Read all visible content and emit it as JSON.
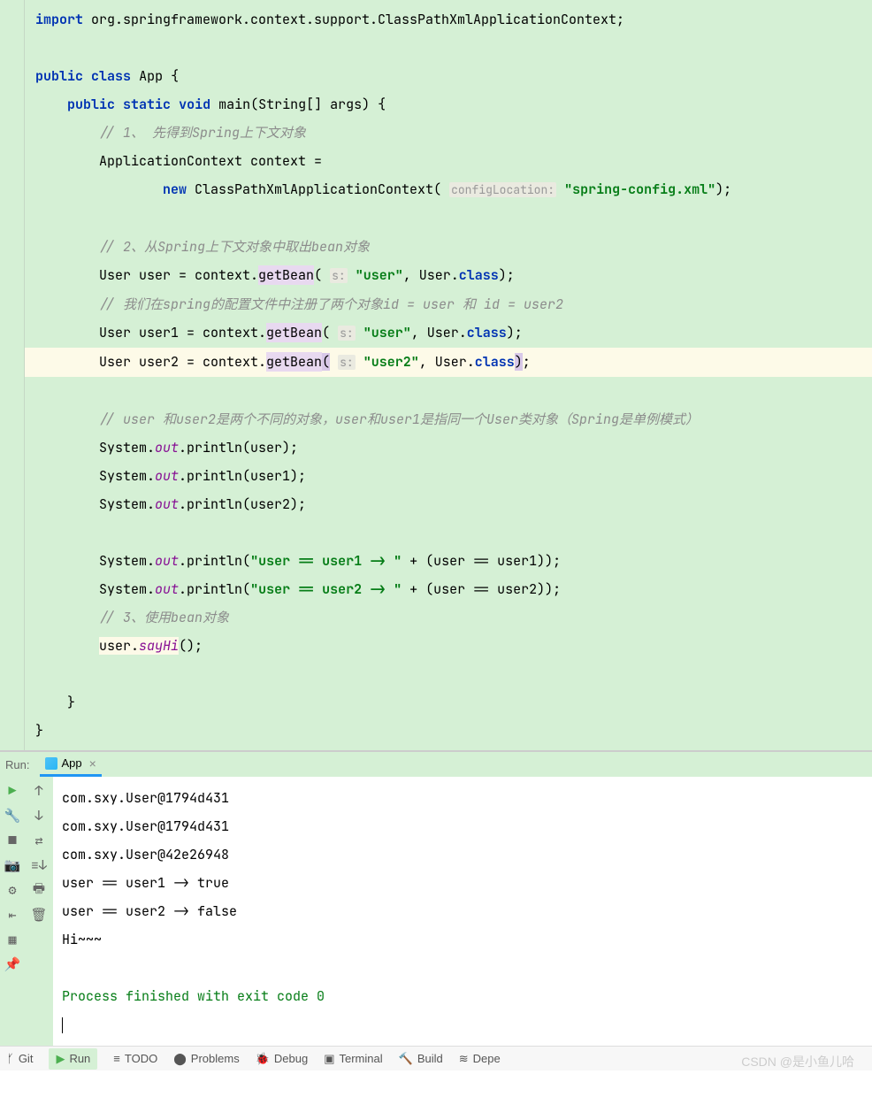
{
  "code": {
    "import": "import",
    "import_pkg": "org.springframework.context.support.ClassPathXmlApplicationContext;",
    "public": "public",
    "class": "class",
    "App": "App {",
    "static": "static",
    "void": "void",
    "main": "main(String[] args) {",
    "new": "new",
    "c1": "// 1、 先得到Spring上下文对象",
    "l1": "ApplicationContext context =",
    "l2a": "ClassPathXmlApplicationContext(",
    "hint_config": "configLocation:",
    "str_config": "\"spring-config.xml\"",
    "l2b": ");",
    "c2": "// 2、从Spring上下文对象中取出bean对象",
    "hint_s": "s:",
    "l3a": "User user = context.",
    "getBean": "getBean",
    "l3b": "(",
    "str_user": "\"user\"",
    "l3c": ", User.",
    "class_kw": "class",
    "l3d": ");",
    "c3": "// 我们在spring的配置文件中注册了两个对象id = user 和 id = user2",
    "l4a": "User user1 = context.",
    "l5a": "User user2 = context.",
    "str_user2": "\"user2\"",
    "c4": "// user 和user2是两个不同的对象，user和user1是指同一个User类对象（Spring是单例模式）",
    "sys": "System.",
    "out": "out",
    "pr1": ".println(user);",
    "pr2": ".println(user1);",
    "pr3": ".println(user2);",
    "str_cmp1": "\"user == user1 -> \"",
    "cmp1b": " + (user == user1));",
    "str_cmp2": "\"user == user2 -> \"",
    "cmp2b": " + (user == user2));",
    "pr_open": ".println(",
    "c5": "// 3、使用bean对象",
    "sayHi_a": "user.",
    "sayHi": "sayHi",
    "sayHi_b": "();",
    "rbrace": "}"
  },
  "run": {
    "label": "Run:",
    "tab": "App",
    "out1": "com.sxy.User@1794d431",
    "out2": "com.sxy.User@1794d431",
    "out3": "com.sxy.User@42e26948",
    "out4": "user == user1 -> true",
    "out5": "user == user2 -> false",
    "out6": "Hi~~~",
    "exit": "Process finished with exit code 0"
  },
  "bottom": {
    "git": "Git",
    "run": "Run",
    "todo": "TODO",
    "problems": "Problems",
    "debug": "Debug",
    "terminal": "Terminal",
    "build": "Build",
    "deps": "Depe"
  },
  "watermark": "CSDN @是小鱼儿哈"
}
